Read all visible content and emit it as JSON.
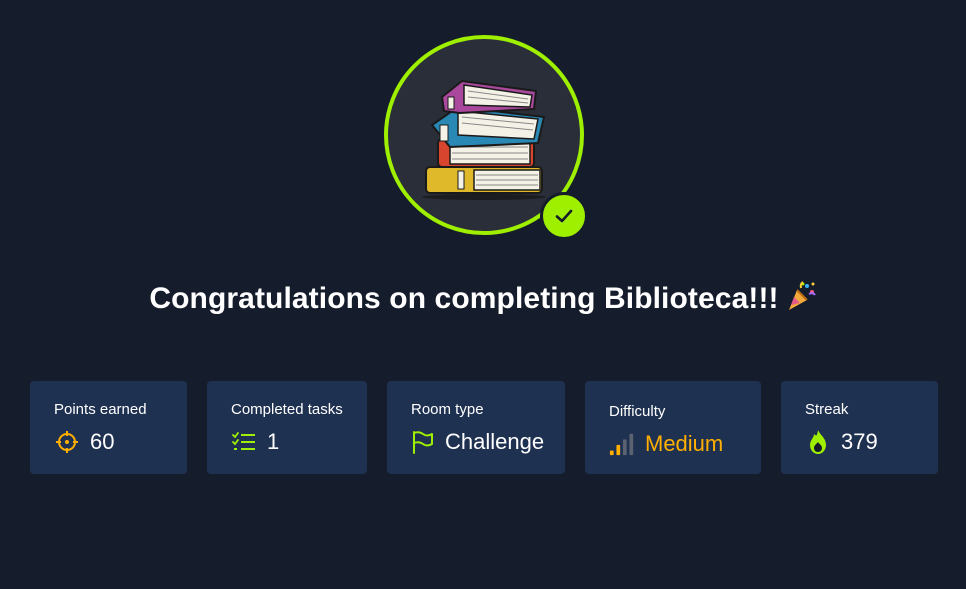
{
  "headline": {
    "text": "Congratulations on completing Biblioteca!!!",
    "emoji": "party-popper"
  },
  "badge": {
    "image": "stack-of-books",
    "completed_icon": "check-icon",
    "ring_color": "#9fef00"
  },
  "stats": [
    {
      "label": "Points earned",
      "value": "60",
      "icon": "target-icon"
    },
    {
      "label": "Completed tasks",
      "value": "1",
      "icon": "checklist-icon"
    },
    {
      "label": "Room type",
      "value": "Challenge",
      "icon": "flag-icon"
    },
    {
      "label": "Difficulty",
      "value": "Medium",
      "icon": "signal-bars-icon",
      "value_color": "#ffaf00"
    },
    {
      "label": "Streak",
      "value": "379",
      "icon": "flame-icon"
    }
  ],
  "colors": {
    "background": "#151c2b",
    "card": "#1f3151",
    "accent": "#9fef00",
    "medium": "#ffaf00"
  }
}
